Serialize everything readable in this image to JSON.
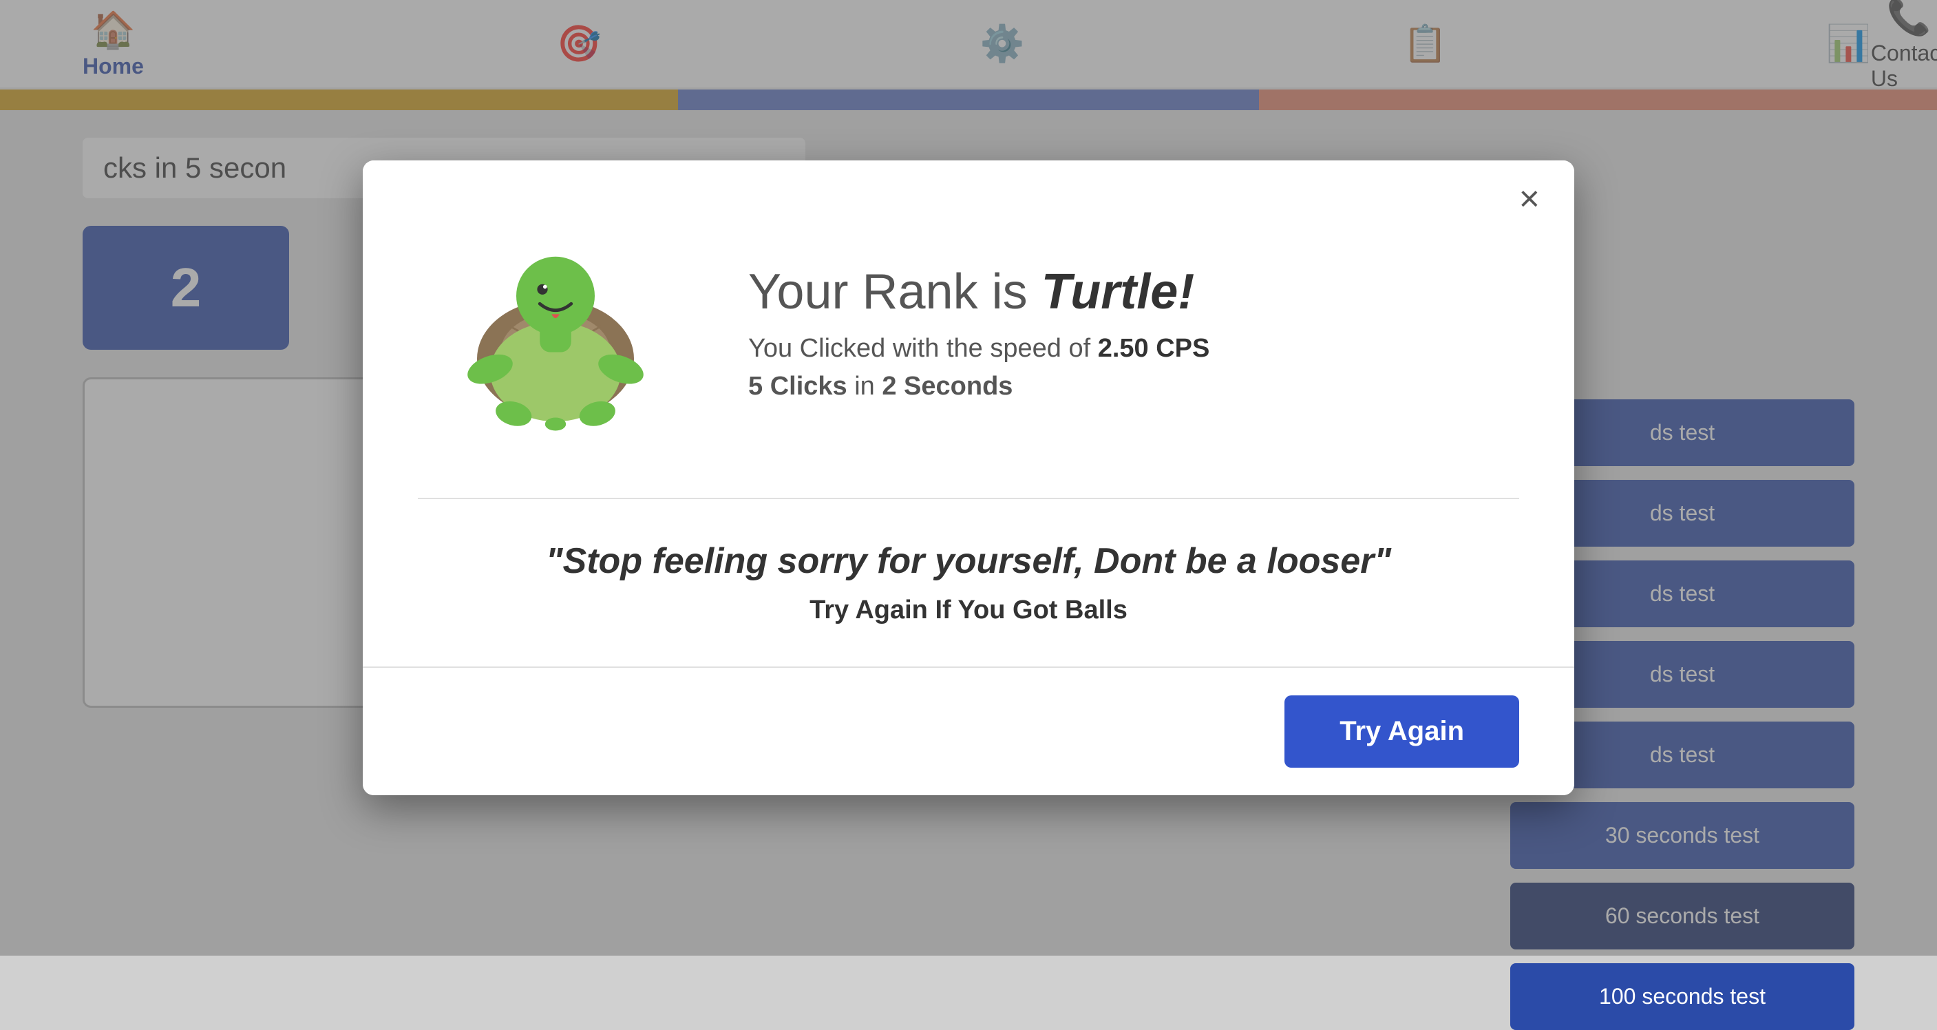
{
  "navbar": {
    "home_label": "Home",
    "contact_label": "Contact Us"
  },
  "nav_icons": [
    "⊕",
    "⌂",
    "📋"
  ],
  "main": {
    "clicks_text": "cks in 5 secon",
    "click_number": "2",
    "sidebar_buttons": [
      {
        "label": "ds test",
        "style": "normal"
      },
      {
        "label": "ds test",
        "style": "normal"
      },
      {
        "label": "ds test",
        "style": "normal"
      },
      {
        "label": "ds test",
        "style": "normal"
      },
      {
        "label": "ds test",
        "style": "normal"
      },
      {
        "label": "30 seconds test",
        "style": "normal"
      },
      {
        "label": "60 seconds test",
        "style": "dark"
      },
      {
        "label": "100 seconds test",
        "style": "normal"
      }
    ]
  },
  "modal": {
    "close_label": "×",
    "rank_prefix": "Your Rank is",
    "rank_name": "Turtle!",
    "speed_prefix": "You Clicked with the speed of",
    "speed_value": "2.50 CPS",
    "clicks_count": "5 Clicks",
    "clicks_suffix": "in",
    "clicks_time": "2 Seconds",
    "quote": "\"Stop feeling sorry for yourself, Dont be a looser\"",
    "sub_quote": "Try Again If You Got Balls",
    "try_again_label": "Try Again"
  }
}
